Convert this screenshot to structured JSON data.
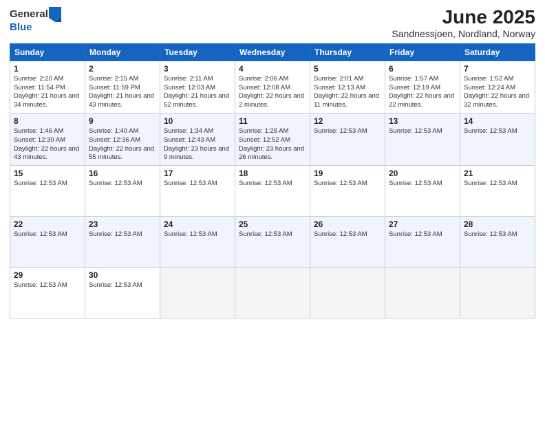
{
  "header": {
    "logo": {
      "general": "General",
      "blue": "Blue"
    },
    "title": "June 2025",
    "subtitle": "Sandnessjoen, Nordland, Norway"
  },
  "days_of_week": [
    "Sunday",
    "Monday",
    "Tuesday",
    "Wednesday",
    "Thursday",
    "Friday",
    "Saturday"
  ],
  "weeks": [
    [
      {
        "num": "1",
        "info": "Sunrise: 2:20 AM\nSunset: 11:54 PM\nDaylight: 21 hours\nand 34 minutes."
      },
      {
        "num": "2",
        "info": "Sunrise: 2:15 AM\nSunset: 11:59 PM\nDaylight: 21 hours\nand 43 minutes."
      },
      {
        "num": "3",
        "info": "Sunrise: 2:11 AM\nSunset: 12:03 AM\nDaylight: 21 hours\nand 52 minutes."
      },
      {
        "num": "4",
        "info": "Sunrise: 2:06 AM\nSunset: 12:08 AM\nDaylight: 22 hours\nand 2 minutes."
      },
      {
        "num": "5",
        "info": "Sunrise: 2:01 AM\nSunset: 12:13 AM\nDaylight: 22 hours\nand 11 minutes."
      },
      {
        "num": "6",
        "info": "Sunrise: 1:57 AM\nSunset: 12:19 AM\nDaylight: 22 hours\nand 22 minutes."
      },
      {
        "num": "7",
        "info": "Sunrise: 1:52 AM\nSunset: 12:24 AM\nDaylight: 22 hours\nand 32 minutes."
      }
    ],
    [
      {
        "num": "8",
        "info": "Sunrise: 1:46 AM\nSunset: 12:30 AM\nDaylight: 22 hours\nand 43 minutes."
      },
      {
        "num": "9",
        "info": "Sunrise: 1:40 AM\nSunset: 12:36 AM\nDaylight: 22 hours\nand 55 minutes."
      },
      {
        "num": "10",
        "info": "Sunrise: 1:34 AM\nSunset: 12:43 AM\nDaylight: 23 hours\nand 9 minutes."
      },
      {
        "num": "11",
        "info": "Sunrise: 1:25 AM\nSunset: 12:52 AM\nDaylight: 23 hours\nand 26 minutes."
      },
      {
        "num": "12",
        "info": "Sunrise: 12:53 AM"
      },
      {
        "num": "13",
        "info": "Sunrise: 12:53 AM"
      },
      {
        "num": "14",
        "info": "Sunrise: 12:53 AM"
      }
    ],
    [
      {
        "num": "15",
        "info": "Sunrise: 12:53 AM"
      },
      {
        "num": "16",
        "info": "Sunrise: 12:53 AM"
      },
      {
        "num": "17",
        "info": "Sunrise: 12:53 AM"
      },
      {
        "num": "18",
        "info": "Sunrise: 12:53 AM"
      },
      {
        "num": "19",
        "info": "Sunrise: 12:53 AM"
      },
      {
        "num": "20",
        "info": "Sunrise: 12:53 AM"
      },
      {
        "num": "21",
        "info": "Sunrise: 12:53 AM"
      }
    ],
    [
      {
        "num": "22",
        "info": "Sunrise: 12:53 AM"
      },
      {
        "num": "23",
        "info": "Sunrise: 12:53 AM"
      },
      {
        "num": "24",
        "info": "Sunrise: 12:53 AM"
      },
      {
        "num": "25",
        "info": "Sunrise: 12:53 AM"
      },
      {
        "num": "26",
        "info": "Sunrise: 12:53 AM"
      },
      {
        "num": "27",
        "info": "Sunrise: 12:53 AM"
      },
      {
        "num": "28",
        "info": "Sunrise: 12:53 AM"
      }
    ],
    [
      {
        "num": "29",
        "info": "Sunrise: 12:53 AM"
      },
      {
        "num": "30",
        "info": "Sunrise: 12:53 AM"
      },
      {
        "num": "",
        "info": ""
      },
      {
        "num": "",
        "info": ""
      },
      {
        "num": "",
        "info": ""
      },
      {
        "num": "",
        "info": ""
      },
      {
        "num": "",
        "info": ""
      }
    ]
  ]
}
